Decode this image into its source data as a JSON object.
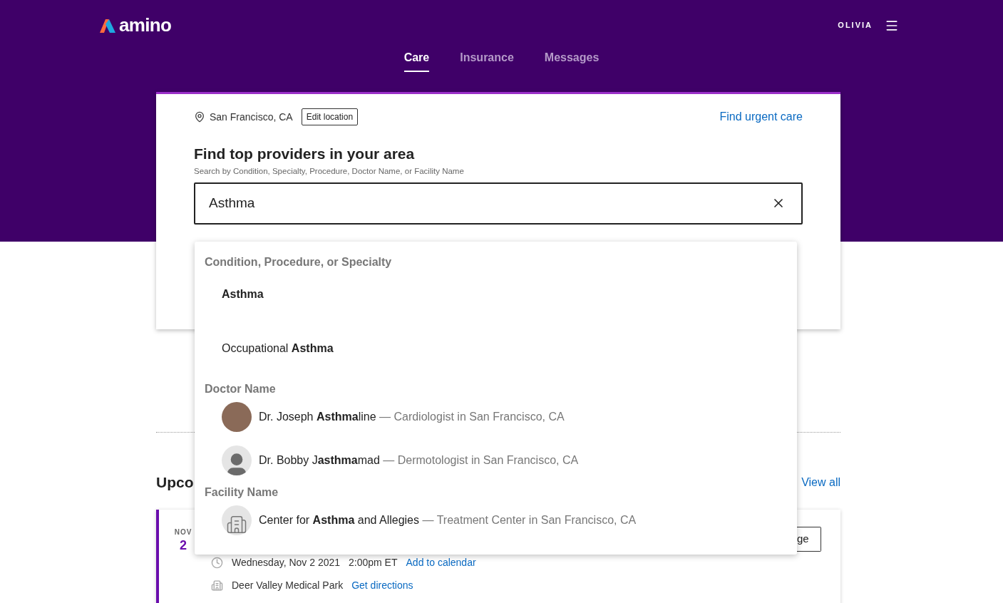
{
  "header": {
    "logo": "amino",
    "user": "OLIVIA"
  },
  "tabs": [
    {
      "label": "Care",
      "selected": true
    },
    {
      "label": "Insurance",
      "selected": false
    },
    {
      "label": "Messages",
      "selected": false
    }
  ],
  "search_card": {
    "location": "San Francisco, CA",
    "edit_button": "Edit location",
    "urgent_link": "Find urgent care",
    "title": "Find top providers in your area",
    "subtitle": "Search by Condition, Specialty, Procedure, Doctor Name, or Facility Name",
    "search": {
      "value": "Asthma"
    }
  },
  "suggestions": [
    {
      "heading": "Condition, Procedure, or Specialty",
      "items": [
        {
          "kind": "text",
          "label": "**Asthma**"
        },
        {
          "kind": "text",
          "label": "Occupational **Asthma**"
        }
      ]
    },
    {
      "heading": "Doctor Name",
      "items": [
        {
          "kind": "photo",
          "label": "Dr. Joseph **Asthma**line",
          "detail": "— Cardiologist in San Francisco, CA"
        },
        {
          "kind": "silhouette",
          "label": "Dr. Bobby J**asthma**mad",
          "detail": "— Dermotologist in San Francisco, CA"
        }
      ]
    },
    {
      "heading": "Facility Name",
      "items": [
        {
          "kind": "building",
          "label": "Center for **Asthma** and Allegies",
          "detail": "— Treatment Center in San Francisco, CA"
        }
      ]
    }
  ],
  "upcoming": {
    "title": "Upco",
    "view_all": "View all",
    "appointment": {
      "month": "NOV",
      "day": "2",
      "button": "ge",
      "date": "Wednesday, Nov 2 2021",
      "time": "2:00pm ET",
      "calendar_link": "Add to calendar",
      "place": "Deer Valley Medical Park",
      "directions_link": "Get directions"
    }
  }
}
